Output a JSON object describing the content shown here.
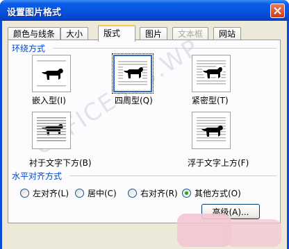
{
  "window": {
    "title": "设置图片格式"
  },
  "tabs": [
    {
      "label": "颜色与线条",
      "active": false,
      "disabled": false
    },
    {
      "label": "大小",
      "active": false,
      "disabled": false
    },
    {
      "label": "版式",
      "active": true,
      "disabled": false
    },
    {
      "label": "图片",
      "active": false,
      "disabled": false
    },
    {
      "label": "文本框",
      "active": false,
      "disabled": true
    },
    {
      "label": "网站",
      "active": false,
      "disabled": false
    }
  ],
  "wrapping": {
    "section_label": "环绕方式",
    "selected": "四周型",
    "options": [
      {
        "label": "嵌入型(I)",
        "icon": "wrap-inline-icon"
      },
      {
        "label": "四周型(Q)",
        "icon": "wrap-square-icon"
      },
      {
        "label": "紧密型(T)",
        "icon": "wrap-tight-icon"
      },
      {
        "label": "衬于文字下方(B)",
        "icon": "wrap-behind-text-icon"
      },
      {
        "label": "浮于文字上方(F)",
        "icon": "wrap-in-front-of-text-icon"
      }
    ]
  },
  "alignment": {
    "section_label": "水平对齐方式",
    "options": [
      {
        "label": "左对齐(L)",
        "checked": false
      },
      {
        "label": "居中(C)",
        "checked": false
      },
      {
        "label": "右对齐(R)",
        "checked": false
      },
      {
        "label": "其他方式(O)",
        "checked": true
      }
    ]
  },
  "buttons": {
    "advanced": "高级(A)..."
  },
  "watermark": {
    "text": "OFFICE365.WP"
  },
  "colors": {
    "accent": "#0046d5",
    "titlebar": "#0850db",
    "face": "#ece9d8"
  }
}
